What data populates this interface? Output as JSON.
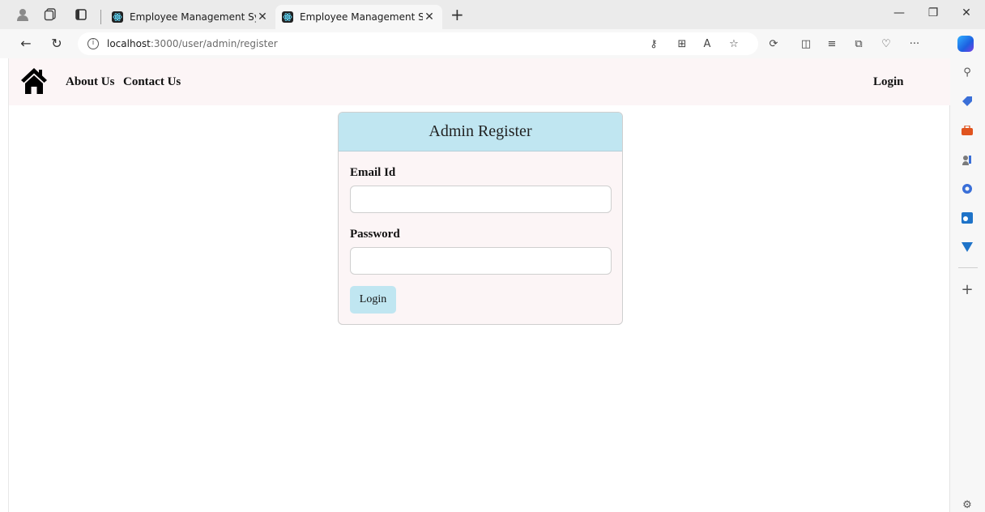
{
  "browser": {
    "tabs": [
      {
        "title": "Employee Management System /",
        "close": "✕"
      },
      {
        "title": "Employee Management System /",
        "close": "✕"
      }
    ],
    "new_tab": "+",
    "url": {
      "host": "localhost",
      "path": ":3000/user/admin/register"
    },
    "window": {
      "minimize": "—",
      "restore": "❐",
      "close": "✕"
    },
    "more": "···"
  },
  "navbar": {
    "about_label": "About Us",
    "contact_label": "Contact Us",
    "login_label": "Login"
  },
  "form": {
    "title": "Admin Register",
    "email_label": "Email Id",
    "email_value": "",
    "password_label": "Password",
    "password_value": "",
    "submit_label": "Login"
  },
  "colors": {
    "navbar_bg": "#fcf5f6",
    "card_header_bg": "#c0e6f1",
    "button_bg": "#c0e6f1"
  }
}
